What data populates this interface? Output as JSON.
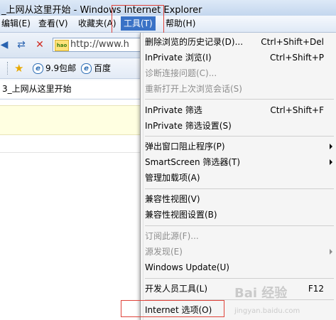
{
  "window": {
    "title": "_上网从这里开始 - Windows Internet Explorer"
  },
  "menubar": {
    "items": [
      "编辑(E)",
      "查看(V)",
      "收藏夹(A)",
      "工具(T)",
      "帮助(H)"
    ],
    "active": "工具(T)"
  },
  "address": {
    "url": "http://www.h"
  },
  "favorites": {
    "items": [
      "9.9包邮",
      "百度"
    ]
  },
  "tab": {
    "title": "3_上网从这里开始"
  },
  "tools_menu": {
    "items": [
      {
        "label": "删除浏览的历史记录(D)...",
        "shortcut": "Ctrl+Shift+Del"
      },
      {
        "label": "InPrivate 浏览(I)",
        "shortcut": "Ctrl+Shift+P"
      },
      {
        "label": "诊断连接问题(C)...",
        "disabled": true
      },
      {
        "label": "重新打开上次浏览会话(S)",
        "disabled": true
      },
      {
        "label": "InPrivate 筛选",
        "shortcut": "Ctrl+Shift+F"
      },
      {
        "label": "InPrivate 筛选设置(S)"
      },
      {
        "label": "弹出窗口阻止程序(P)",
        "submenu": true
      },
      {
        "label": "SmartScreen 筛选器(T)",
        "submenu": true
      },
      {
        "label": "管理加载项(A)"
      },
      {
        "label": "兼容性视图(V)"
      },
      {
        "label": "兼容性视图设置(B)"
      },
      {
        "label": "订阅此源(F)...",
        "disabled": true
      },
      {
        "label": "源发现(E)",
        "disabled": true,
        "submenu": true
      },
      {
        "label": "Windows Update(U)"
      },
      {
        "label": "开发人员工具(L)",
        "shortcut": "F12"
      },
      {
        "label": "Internet 选项(O)"
      }
    ]
  },
  "watermark": {
    "text": "Bai 经验",
    "sub": "jingyan.baidu.com"
  },
  "colors": {
    "menu_highlight": "#3a72c6",
    "annotation_box": "#e0433a"
  }
}
